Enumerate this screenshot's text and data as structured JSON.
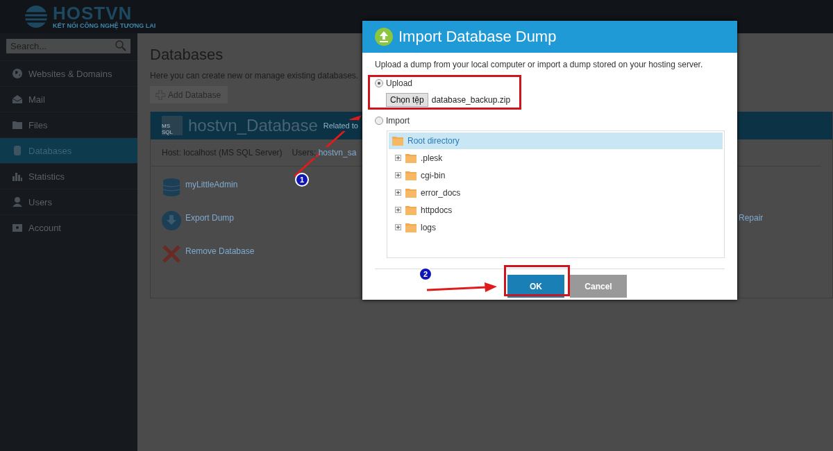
{
  "header": {
    "logo": "HOSTVN",
    "tagline": "KẾT NỐI CÔNG NGHỆ TƯƠNG LAI"
  },
  "sidebar": {
    "search": {
      "placeholder": "Search..."
    },
    "items": [
      {
        "label": "Websites & Domains",
        "kind": "globe",
        "selected": false
      },
      {
        "label": "Mail",
        "kind": "mail",
        "selected": false
      },
      {
        "label": "Files",
        "kind": "folder",
        "selected": false
      },
      {
        "label": "Databases",
        "kind": "database",
        "selected": true
      },
      {
        "label": "Statistics",
        "kind": "chart",
        "selected": false
      },
      {
        "label": "Users",
        "kind": "user",
        "selected": false
      },
      {
        "label": "Account",
        "kind": "account",
        "selected": false
      }
    ]
  },
  "page": {
    "title": "Databases",
    "description": "Here you can create new or manage existing databases.",
    "add_button": "Add Database",
    "database": {
      "badge": "MS SQL",
      "name": "hostvn_Database",
      "related": "Related to",
      "host": "Host: localhost (MS SQL Server)",
      "users_label": "Users:",
      "user": "hostvn_sa",
      "actions": [
        {
          "label": "myLittleAdmin",
          "kind": "db"
        },
        {
          "label": "Export Dump",
          "kind": "export"
        },
        {
          "label": "Remove Database",
          "kind": "remove"
        }
      ],
      "side_action": "Repair"
    }
  },
  "dialog": {
    "title": "Import Database Dump",
    "description": "Upload a dump from your local computer or import a dump stored on your hosting server.",
    "options": [
      {
        "label": "Upload",
        "selected": true
      },
      {
        "label": "Import",
        "selected": false
      }
    ],
    "file_button": "Chọn tệp",
    "file_name": "database_backup.zip",
    "tree": {
      "label": "Root directory",
      "selected": true,
      "children": [
        {
          "label": ".plesk",
          "expanded": false
        },
        {
          "label": "cgi-bin",
          "expanded": false
        },
        {
          "label": "error_docs",
          "expanded": false
        },
        {
          "label": "httpdocs",
          "expanded": false
        },
        {
          "label": "logs",
          "expanded": false
        }
      ]
    },
    "buttons": [
      {
        "label": "OK",
        "kind": "primary"
      },
      {
        "label": "Cancel",
        "kind": "secondary"
      }
    ]
  },
  "annotations": [
    {
      "label": "1"
    },
    {
      "label": "2"
    }
  ]
}
